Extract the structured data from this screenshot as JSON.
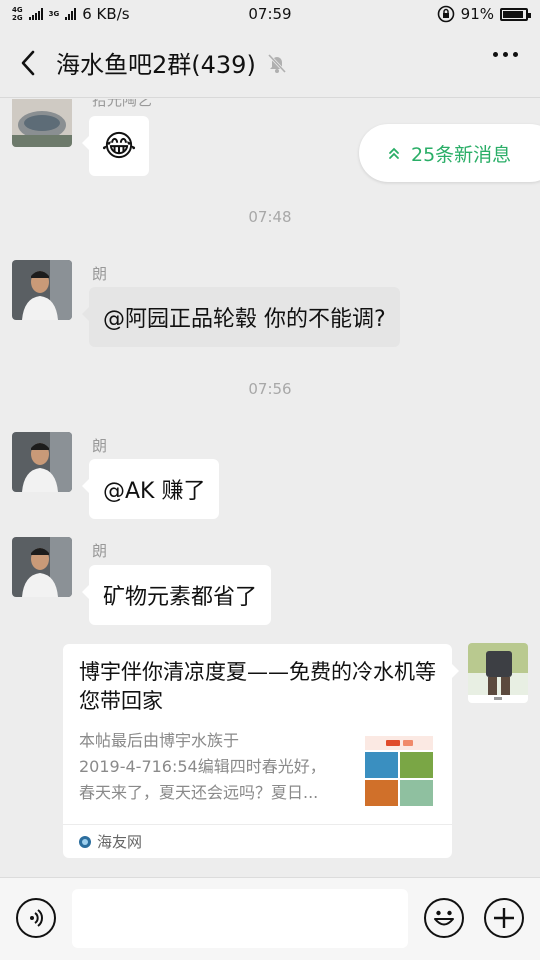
{
  "status_bar": {
    "net_top": "4G",
    "net_bottom": "2G",
    "net_3g": "3G",
    "speed": "6 KB/s",
    "time": "07:59",
    "battery": "91%",
    "battery_level": 0.91
  },
  "header": {
    "title": "海水鱼吧2群(439)",
    "icons": [
      "back-arrow-icon",
      "mute-bell-icon",
      "more-icon"
    ]
  },
  "new_messages": {
    "label": "25条新消息",
    "icon": "double-chevron-up-icon",
    "color": "#2aae67"
  },
  "messages": [
    {
      "nickname": "拾光陶艺",
      "content": "😂",
      "type": "emoji"
    },
    {
      "time": "07:48"
    },
    {
      "nickname": "朗",
      "content": "@阿园正品轮毂  你的不能调?",
      "type": "text"
    },
    {
      "time": "07:56"
    },
    {
      "nickname": "朗",
      "content": "@AK  赚了",
      "type": "text"
    },
    {
      "nickname": "朗",
      "content": "矿物元素都省了",
      "type": "text"
    },
    {
      "type": "link",
      "title": "博宇伴你清凉度夏——免费的冷水机等您带回家",
      "desc_lines": [
        "本帖最后由博宇水族于",
        "2019-4-716:54编辑四时春光好，",
        "春天来了，夏天还会远吗？夏日..."
      ],
      "source": "海友网"
    }
  ],
  "input_bar": {
    "icons": [
      "voice-icon",
      "emoji-icon",
      "plus-icon"
    ],
    "text_value": ""
  }
}
